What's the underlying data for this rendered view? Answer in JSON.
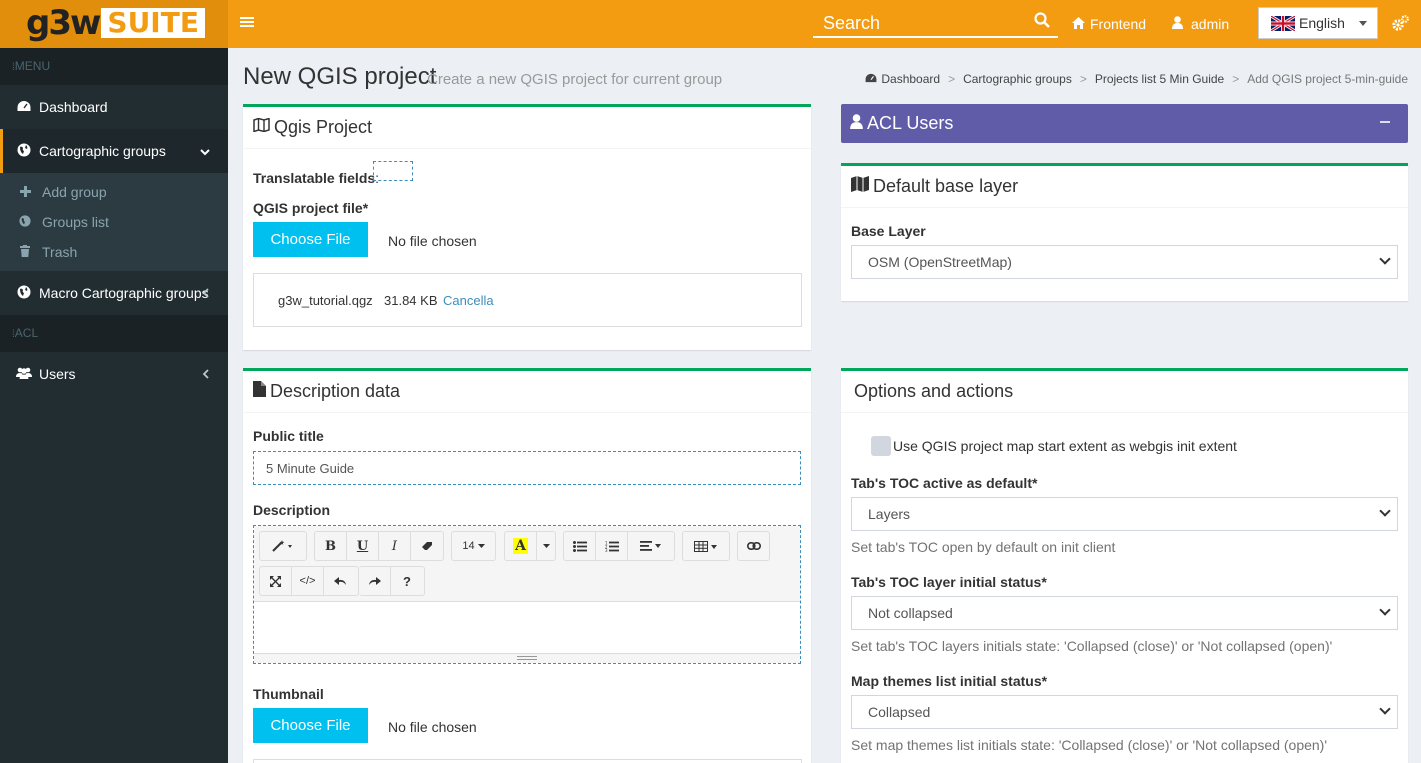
{
  "header": {
    "logo_main": "g3w",
    "logo_suite": "SUITE",
    "search_placeholder": "Search",
    "frontend_label": "Frontend",
    "admin_label": "admin",
    "language": "English"
  },
  "sidebar": {
    "menu_header": "MENU",
    "acl_header": "ACL",
    "dashboard": "Dashboard",
    "cartographic_groups": "Cartographic groups",
    "sub_items": [
      "Add group",
      "Groups list",
      "Trash"
    ],
    "macro_groups": "Macro Cartographic groups",
    "users": "Users"
  },
  "page": {
    "title": "New QGIS project",
    "subtitle": "Create a new QGIS project for current group"
  },
  "breadcrumb": [
    "Dashboard",
    "Cartographic groups",
    "Projects list 5 Min Guide",
    "Add QGIS project 5-min-guide"
  ],
  "qgis_box": {
    "title": "Qgis Project",
    "translatable_label": "Translatable fields",
    "colon": ":",
    "file_label": "QGIS project file*",
    "choose_file": "Choose File",
    "no_file": "No file chosen",
    "uploaded_name": "g3w_tutorial.qgz",
    "uploaded_size": "31.84 KB",
    "cancel_link": "Cancella"
  },
  "description_box": {
    "title": "Description data",
    "public_title_label": "Public title",
    "public_title_value": "5 Minute Guide",
    "description_label": "Description",
    "font_size": "14",
    "thumbnail_label": "Thumbnail",
    "choose_file": "Choose File",
    "no_file": "No file chosen"
  },
  "acl_box": {
    "title": "ACL Users",
    "collapse": "−",
    "color": "#605ca8"
  },
  "base_layer_box": {
    "title": "Default base layer",
    "label": "Base Layer",
    "value": "OSM (OpenStreetMap)"
  },
  "options_box": {
    "title": "Options and actions",
    "checkbox_label": "Use QGIS project map start extent as webgis init extent",
    "toc_tab_label": "Tab's TOC active as default*",
    "toc_tab_value": "Layers",
    "toc_tab_help": "Set tab's TOC open by default on init client",
    "toc_layer_label": "Tab's TOC layer initial status*",
    "toc_layer_value": "Not collapsed",
    "toc_layer_help": "Set tab's TOC layers initials state: 'Collapsed (close)' or 'Not collapsed (open)'",
    "themes_label": "Map themes list initial status*",
    "themes_value": "Collapsed",
    "themes_help": "Set map themes list initials state: 'Collapsed (close)' or 'Not collapsed (open)'"
  },
  "colors": {
    "accent": "#f39c12",
    "sidebar": "#222d32",
    "success": "#00a65a",
    "info": "#00c0ef"
  }
}
